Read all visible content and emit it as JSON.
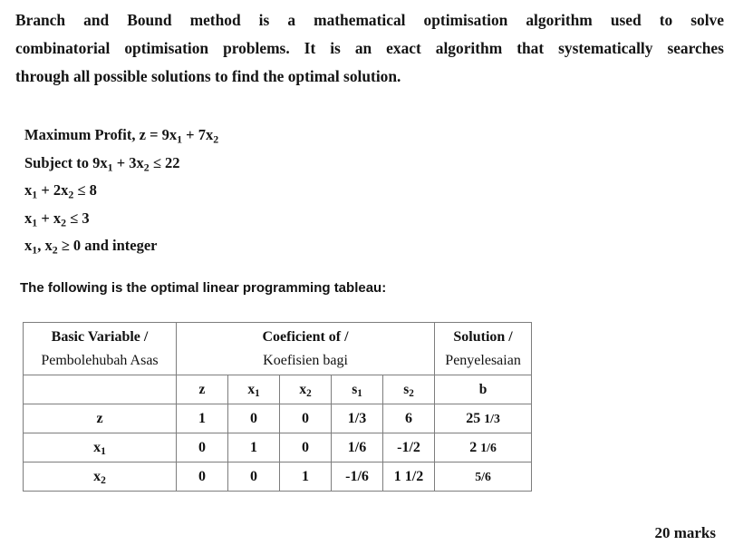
{
  "intro": {
    "line1": "Branch and Bound method is a mathematical optimisation algorithm used to solve",
    "line1_words": [
      "Branch",
      "and",
      "Bound",
      "method",
      "is",
      "a",
      "mathematical",
      "optimisation",
      "algorithm",
      "used",
      "to",
      "solve"
    ],
    "line2_words": [
      "combinatorial",
      "optimisation",
      "problems.",
      "It",
      "is",
      "an",
      "exact",
      "algorithm",
      "that",
      "systematically",
      "searches"
    ],
    "line3": "through all possible solutions to find the optimal solution."
  },
  "model": {
    "objective_label": "Maximum Profit, z = 9x",
    "objective_sub1": "1",
    "objective_mid": " + 7x",
    "objective_sub2": "2",
    "constraint1_a": "Subject to 9x",
    "constraint1_s1": "1",
    "constraint1_b": " + 3x",
    "constraint1_s2": "2",
    "constraint1_c": " ≤ 22",
    "constraint2_a": "x",
    "constraint2_s1": "1",
    "constraint2_b": " + 2x",
    "constraint2_s2": "2",
    "constraint2_c": " ≤ 8",
    "constraint3_a": "x",
    "constraint3_s1": "1",
    "constraint3_b": " + x",
    "constraint3_s2": "2",
    "constraint3_c": " ≤ 3",
    "constraint4_a": "x",
    "constraint4_s1": "1",
    "constraint4_b": ", x",
    "constraint4_s2": "2",
    "constraint4_c": " ≥ 0 and integer"
  },
  "tableau_lead": "The following is the optimal linear programming tableau:",
  "tableau": {
    "header_top": [
      {
        "en": "Basic Variable /",
        "ms": "Pembolehubah Asas"
      },
      {
        "en": "Coeficient of /",
        "ms": "Koefisien bagi"
      },
      {
        "en": "Solution /",
        "ms": "Penyelesaian"
      }
    ],
    "subheader": [
      "",
      "z",
      "x₁",
      "x₂",
      "s₁",
      "s₂",
      "b"
    ],
    "subheader_plain": {
      "blank": "",
      "z": "z",
      "x1_base": "x",
      "x1_sub": "1",
      "x2_base": "x",
      "x2_sub": "2",
      "s1_base": "s",
      "s1_sub": "1",
      "s2_base": "s",
      "s2_sub": "2",
      "b": "b"
    },
    "rows": [
      {
        "basic_base": "z",
        "basic_sub": "",
        "z": "1",
        "x1": "0",
        "x2": "0",
        "s1": "1/3",
        "s2": "6",
        "b_whole": "25",
        "b_frac": "1/3"
      },
      {
        "basic_base": "x",
        "basic_sub": "1",
        "z": "0",
        "x1": "1",
        "x2": "0",
        "s1": "1/6",
        "s2": "-1/2",
        "b_whole": "2",
        "b_frac": "1/6"
      },
      {
        "basic_base": "x",
        "basic_sub": "2",
        "z": "0",
        "x1": "0",
        "x2": "1",
        "s1": "-1/6",
        "s2": "1 1/2",
        "b_whole": "",
        "b_frac": "5/6"
      }
    ]
  },
  "footer": {
    "marks": "20 marks"
  },
  "colors": {
    "text": "#141414",
    "border": "#7d7d7d",
    "background": "#ffffff"
  }
}
